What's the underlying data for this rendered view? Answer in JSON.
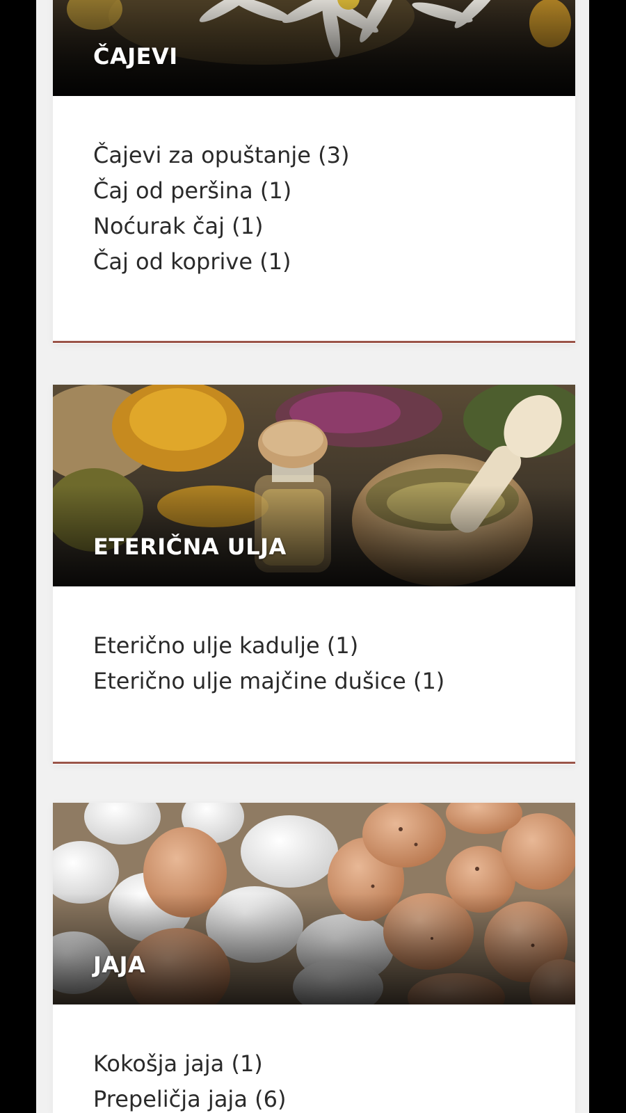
{
  "categories": [
    {
      "title": "ČAJEVI",
      "image": "chamomile-tea-photo",
      "items": [
        "Čajevi za opuštanje (3)",
        "Čaj od peršina (1)",
        "Noćurak čaj (1)",
        "Čaj od koprive (1)"
      ]
    },
    {
      "title": "ETERIČNA ULJA",
      "image": "herbs-oil-mortar-photo",
      "items": [
        "Eterično ulje kadulje (1)",
        "Eterično ulje majčine dušice (1)"
      ]
    },
    {
      "title": "JAJA",
      "image": "eggs-photo",
      "items": [
        "Kokošja jaja (1)",
        "Prepeličja jaja (6)"
      ]
    }
  ],
  "colors": {
    "accent_divider": "#9a5448",
    "page_background": "#f1f1f1",
    "outer_background": "#000000"
  }
}
